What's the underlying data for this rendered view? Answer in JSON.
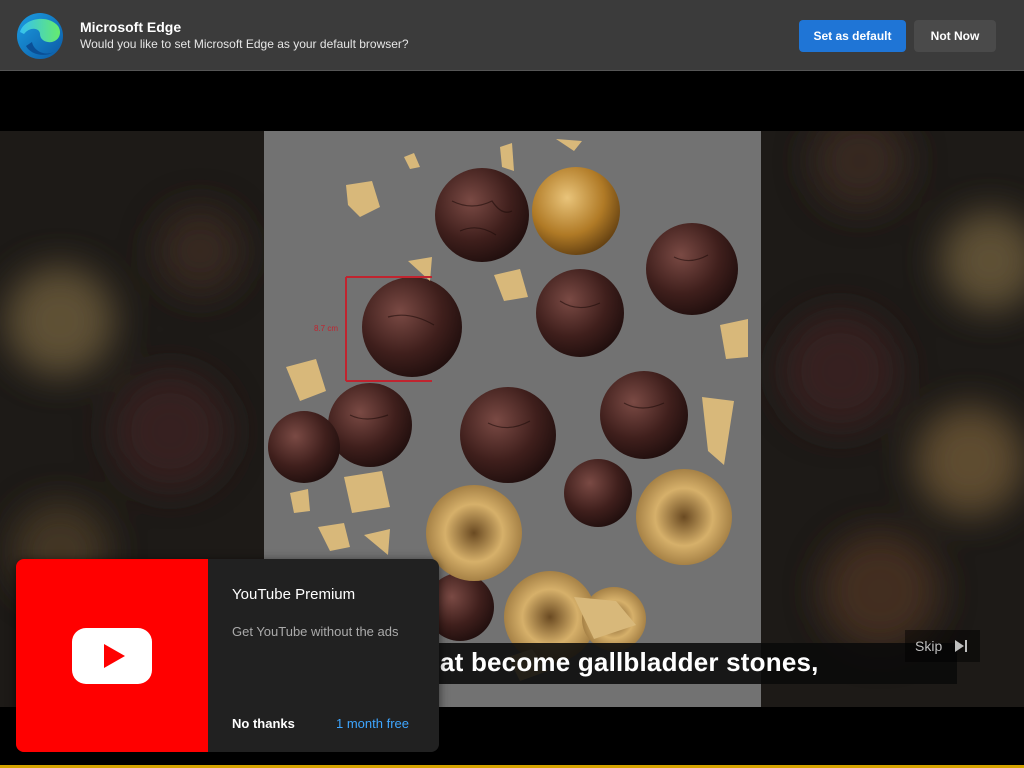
{
  "edge_prompt": {
    "title": "Microsoft Edge",
    "question": "Would you like to set Microsoft Edge as your default browser?",
    "set_default_label": "Set as default",
    "not_now_label": "Not Now"
  },
  "video": {
    "caption": "at become gallbladder stones,",
    "measure_label": "8.7 cm",
    "skip_label": "Skip"
  },
  "premium_promo": {
    "title": "YouTube Premium",
    "description": "Get YouTube without the ads",
    "decline_label": "No thanks",
    "trial_label": "1 month free"
  },
  "colors": {
    "edge_bar": "#3b3b3b",
    "primary_button": "#1f75d6",
    "youtube_red": "#ff0000",
    "promo_background": "#212121",
    "trial_link": "#3ea6ff",
    "bottom_accent": "#d4a300"
  },
  "icons": {
    "edge_logo": "edge-logo-icon",
    "youtube_logo": "youtube-play-icon",
    "skip": "skip-next-icon"
  }
}
